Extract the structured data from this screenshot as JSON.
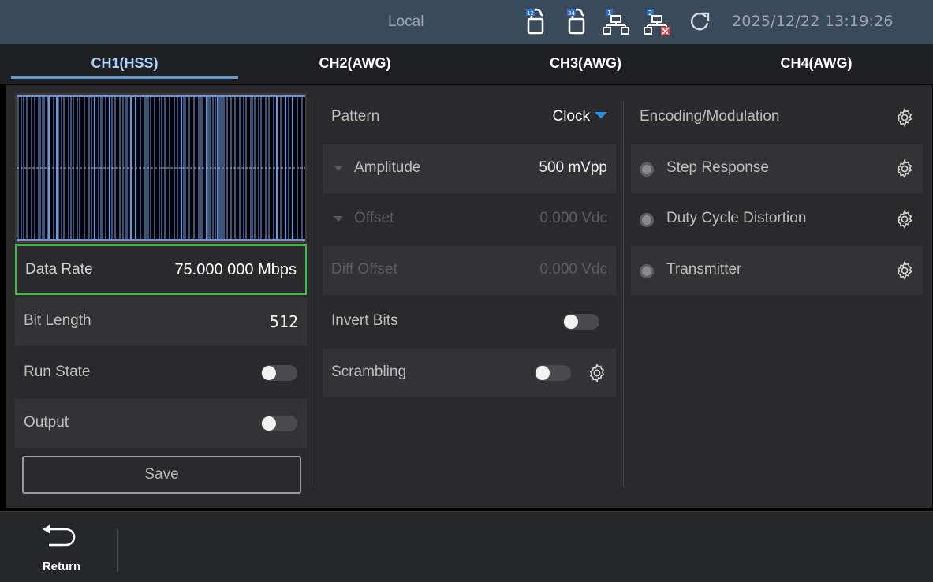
{
  "status": {
    "mode": "Local",
    "datetime": "2025/12/22 13:19:26",
    "icons": [
      "channel-12-lock-icon",
      "channel-34-lock-icon",
      "network-1-icon",
      "network-2-disconnected-icon",
      "refresh-circle-icon"
    ],
    "icon_badges": [
      "12",
      "34",
      "1",
      "2"
    ]
  },
  "tabs": [
    {
      "label": "CH1(HSS)",
      "active": true
    },
    {
      "label": "CH2(AWG)",
      "active": false
    },
    {
      "label": "CH3(AWG)",
      "active": false
    },
    {
      "label": "CH4(AWG)",
      "active": false
    }
  ],
  "left": {
    "data_rate_label": "Data Rate",
    "data_rate_value": "75.000 000 Mbps",
    "bit_length_label": "Bit Length",
    "bit_length_value": "512",
    "run_state_label": "Run State",
    "run_state_on": false,
    "output_label": "Output",
    "output_on": false,
    "save_label": "Save"
  },
  "middle": {
    "pattern_label": "Pattern",
    "pattern_value": "Clock",
    "amplitude_label": "Amplitude",
    "amplitude_value": "500 mVpp",
    "offset_label": "Offset",
    "offset_value": "0.000 Vdc",
    "diff_offset_label": "Diff Offset",
    "diff_offset_value": "0.000 Vdc",
    "invert_bits_label": "Invert Bits",
    "invert_bits_on": false,
    "scrambling_label": "Scrambling",
    "scrambling_on": false
  },
  "right": {
    "encoding_label": "Encoding/Modulation",
    "items": [
      {
        "label": "Step Response",
        "enabled": false
      },
      {
        "label": "Duty Cycle Distortion",
        "enabled": false
      },
      {
        "label": "Transmitter",
        "enabled": false
      }
    ]
  },
  "bottom": {
    "return_label": "Return"
  },
  "colors": {
    "accent": "#5b9bd5",
    "selection": "#3bbf3b",
    "pattern_caret": "#2f8fe0",
    "waveform": "#6f95d8"
  }
}
